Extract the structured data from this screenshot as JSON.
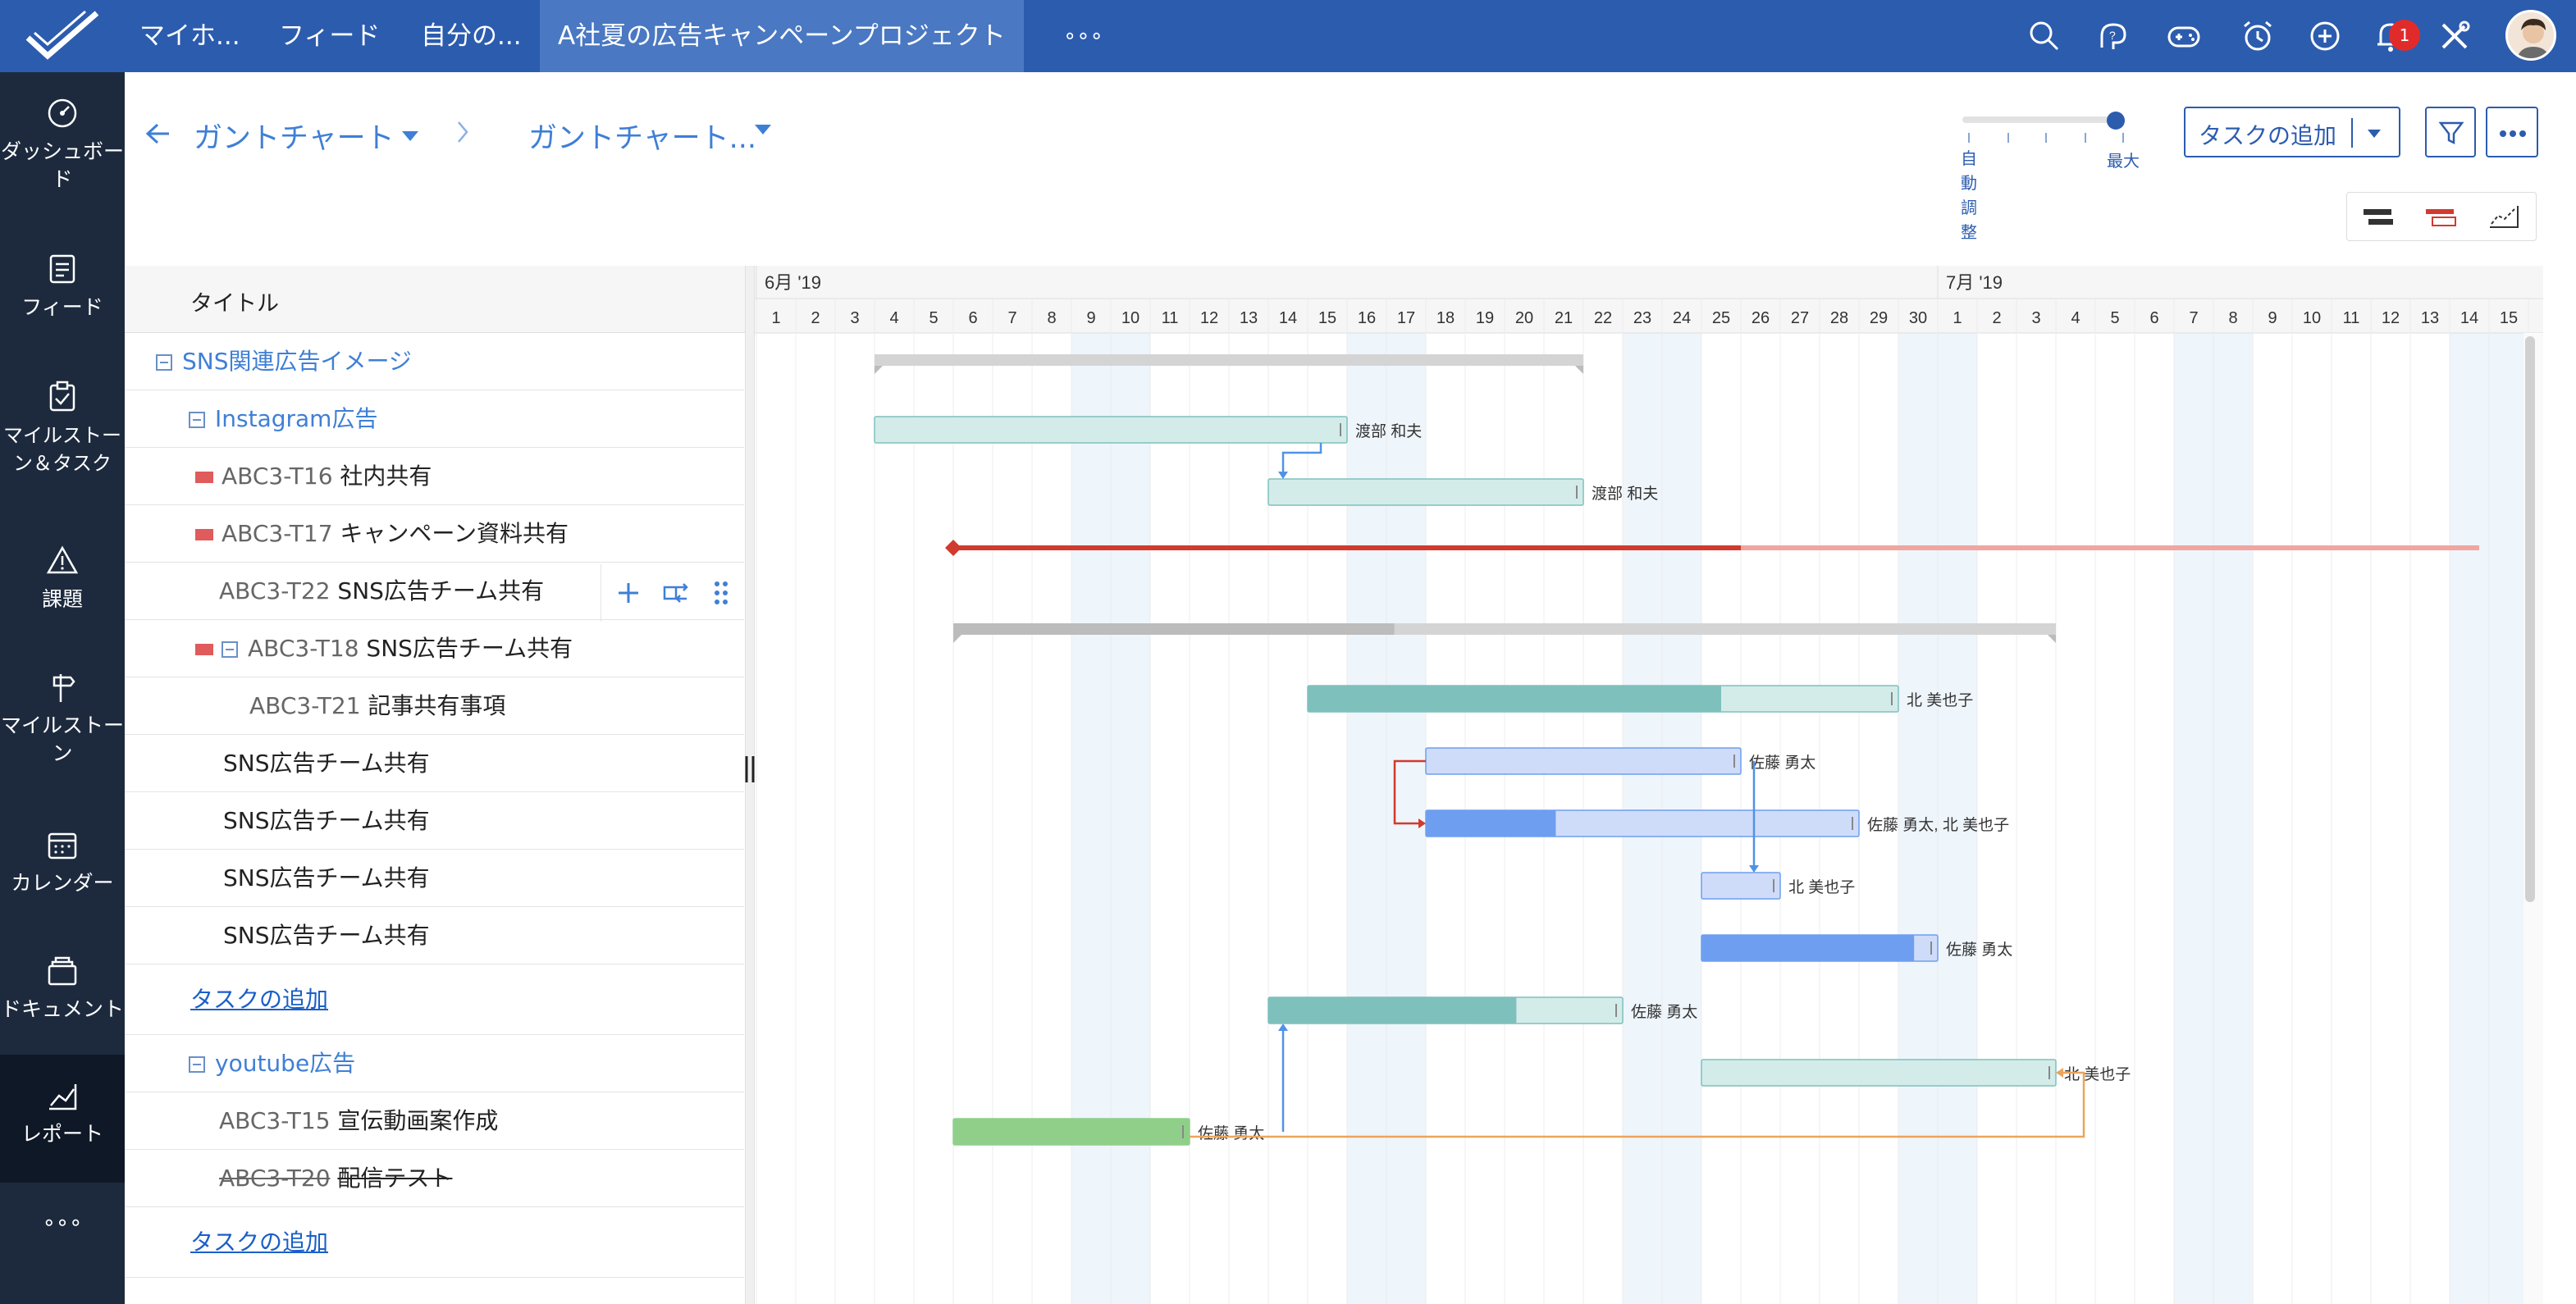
{
  "topbar": {
    "tabs": [
      "マイホ...",
      "フィード",
      "自分の...",
      "A社夏の広告キャンペーンプロジェクト",
      "∘∘∘"
    ],
    "notification_count": "1",
    "icons": [
      "search-icon",
      "help-icon",
      "gamepad-icon",
      "timer-icon",
      "add-circle-icon",
      "bell-icon",
      "tools-icon",
      "avatar"
    ]
  },
  "sidebar": {
    "items": [
      {
        "label": "ダッシュボード",
        "icon": "dashboard-icon"
      },
      {
        "label": "フィード",
        "icon": "feed-icon"
      },
      {
        "label": "マイルストーン＆タスク",
        "icon": "milestone-task-icon"
      },
      {
        "label": "課題",
        "icon": "warning-icon"
      },
      {
        "label": "マイルストーン",
        "icon": "signpost-icon"
      },
      {
        "label": "カレンダー",
        "icon": "calendar-icon"
      },
      {
        "label": "ドキュメント",
        "icon": "documents-icon"
      },
      {
        "label": "レポート",
        "icon": "report-icon"
      },
      {
        "label": "∘∘∘",
        "icon": "more-icon"
      }
    ]
  },
  "header": {
    "crumb1": "ガントチャート",
    "crumb2": "ガントチャート...",
    "zoom_min": "自動調整",
    "zoom_max": "最大",
    "zoom_level": 1.0,
    "add_task_button": "タスクの追加"
  },
  "list": {
    "title_header": "タイトル",
    "rows": [
      {
        "kind": "group",
        "title": "SNS関連広告イメージ"
      },
      {
        "kind": "sub",
        "title": "Instagram広告"
      },
      {
        "kind": "task",
        "code": "ABC3-T16",
        "title": "社内共有",
        "priority": true
      },
      {
        "kind": "task",
        "code": "ABC3-T17",
        "title": "キャンペーン資料共有",
        "priority": true
      },
      {
        "kind": "task",
        "code": "ABC3-T22",
        "title": "SNS広告チーム共有",
        "hover": true
      },
      {
        "kind": "task",
        "code": "ABC3-T18",
        "title": "SNS広告チーム共有",
        "priority": true,
        "toggle": true
      },
      {
        "kind": "subtask",
        "code": "ABC3-T21",
        "title": "記事共有事項"
      },
      {
        "kind": "plain",
        "title": "SNS広告チーム共有"
      },
      {
        "kind": "plain",
        "title": "SNS広告チーム共有"
      },
      {
        "kind": "plain",
        "title": "SNS広告チーム共有"
      },
      {
        "kind": "plain",
        "title": "SNS広告チーム共有"
      },
      {
        "kind": "add",
        "title": "タスクの追加"
      },
      {
        "kind": "sub",
        "title": "youtube広告"
      },
      {
        "kind": "task",
        "code": "ABC3-T15",
        "title": "宣伝動画案作成"
      },
      {
        "kind": "task",
        "code": "ABC3-T20",
        "title": "配信テスト",
        "done": true
      },
      {
        "kind": "add",
        "title": "タスクの追加"
      }
    ]
  },
  "gantt": {
    "months": [
      {
        "label": "6月 '19",
        "start": 1
      },
      {
        "label": "7月 '19",
        "start": 31
      }
    ],
    "day_labels": [
      1,
      2,
      3,
      4,
      5,
      6,
      7,
      8,
      9,
      10,
      11,
      12,
      13,
      14,
      15,
      16,
      17,
      18,
      19,
      20,
      21,
      22,
      23,
      24,
      25,
      26,
      27,
      28,
      29,
      30,
      1,
      2,
      3,
      4,
      5,
      6,
      7,
      8,
      9,
      10,
      11,
      12,
      13,
      14,
      15
    ],
    "weekend_days": [
      9,
      10,
      16,
      17,
      23,
      24,
      30,
      31,
      37,
      38,
      44,
      45
    ],
    "bars": [
      {
        "row": 0,
        "type": "summary",
        "start": 4,
        "end": 21
      },
      {
        "row": 1,
        "type": "task",
        "start": 4,
        "end": 15,
        "progress": 0,
        "color": "teal",
        "assignee": "渡部 和夫"
      },
      {
        "row": 2,
        "type": "task",
        "start": 14,
        "end": 21,
        "progress": 0,
        "color": "teal",
        "assignee": "渡部 和夫"
      },
      {
        "row": 3,
        "type": "milestone",
        "start": 6,
        "end": 45
      },
      {
        "row": 4,
        "type": "summary",
        "start": 6,
        "end": 33,
        "progress": 0.4
      },
      {
        "row": 5,
        "type": "task",
        "start": 15,
        "end": 29,
        "progress": 0.7,
        "color": "teal",
        "assignee": "北 美也子"
      },
      {
        "row": 6,
        "type": "task",
        "start": 18,
        "end": 25,
        "progress": 0,
        "color": "blue",
        "assignee": "佐藤 勇太"
      },
      {
        "row": 7,
        "type": "task",
        "start": 18,
        "end": 28,
        "progress": 0.3,
        "color": "blue",
        "assignee": "佐藤 勇太, 北 美也子"
      },
      {
        "row": 8,
        "type": "task",
        "start": 25,
        "end": 26,
        "progress": 0,
        "color": "blue",
        "assignee": "北 美也子"
      },
      {
        "row": 9,
        "type": "task",
        "start": 25,
        "end": 30,
        "progress": 0.9,
        "color": "blue",
        "assignee": "佐藤 勇太"
      },
      {
        "row": 10,
        "type": "task",
        "start": 14,
        "end": 22,
        "progress": 0.7,
        "color": "teal",
        "assignee": "佐藤 勇太"
      },
      {
        "row": 11,
        "type": "task",
        "start": 25,
        "end": 33,
        "progress": 0,
        "color": "teal",
        "assignee": "北 美也子"
      },
      {
        "row": 12,
        "type": "task",
        "start": 6,
        "end": 11,
        "progress": 1,
        "color": "green",
        "assignee": "佐藤 勇太"
      }
    ],
    "colors": {
      "teal": "#7ec0bc",
      "teal_light": "#d3ecea",
      "blue": "#6e9ef0",
      "blue_light": "#cfdcf9",
      "green": "#8fcf8a",
      "milestone": "#d13a2e",
      "milestone_light": "#f0a5a0",
      "summary": "#d4d4d4",
      "summary_dark": "#bcbcbc",
      "dep_blue": "#4f93e6",
      "dep_red": "#d13a2e",
      "dep_orange": "#eca45c"
    }
  }
}
